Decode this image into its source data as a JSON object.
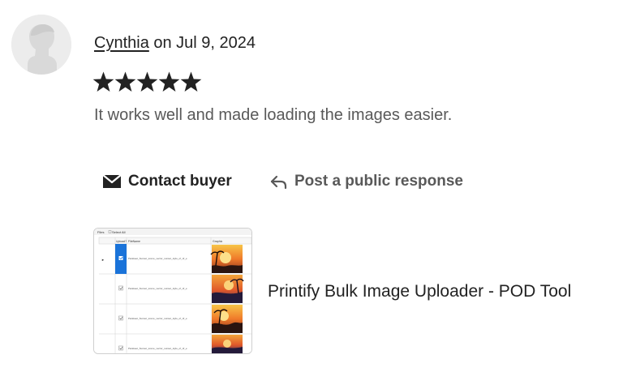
{
  "review": {
    "reviewer_name": "Cynthia",
    "date_text": " on Jul 9, 2024",
    "rating": 5,
    "rating_max": 5,
    "star_color": "#222222",
    "text": "It works well and made loading the images easier."
  },
  "actions": {
    "contact_label": "Contact buyer",
    "contact_icon": "envelope-icon",
    "respond_label": "Post a public response",
    "respond_icon": "reply-arrow-icon"
  },
  "listing": {
    "title": "Printify Bulk Image Uploader - POD Tool",
    "thumbnail": {
      "toolbar_items": [
        "Files",
        "Select All"
      ],
      "columns": [
        "Upload?",
        "FileName",
        "Graphic"
      ],
      "row_count": 4,
      "selected_row": 1,
      "row_text": "Parakeet_Sunset_scene_vector_sunset_style_of_dr_e"
    }
  }
}
